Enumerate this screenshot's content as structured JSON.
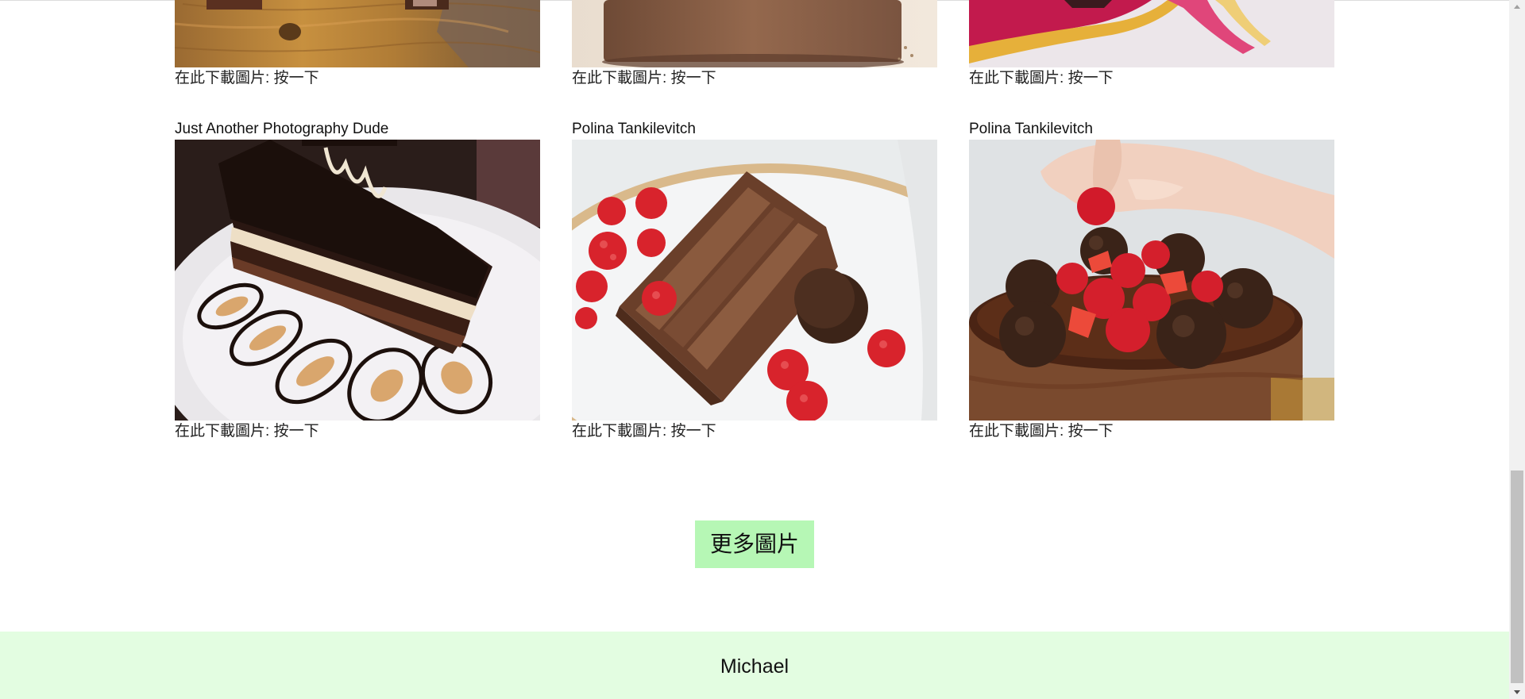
{
  "gallery": {
    "top_row": [
      {
        "download_label": "在此下載圖片: ",
        "download_link": "按一下"
      },
      {
        "download_label": "在此下載圖片: ",
        "download_link": "按一下"
      },
      {
        "download_label": "在此下載圖片: ",
        "download_link": "按一下"
      }
    ],
    "bottom_row": [
      {
        "author": "Just Another Photography Dude",
        "download_label": "在此下載圖片: ",
        "download_link": "按一下",
        "photo": "chocolate-cake-slice-on-plate-photo"
      },
      {
        "author": "Polina Tankilevitch",
        "download_label": "在此下載圖片: ",
        "download_link": "按一下",
        "photo": "chocolate-layer-cake-with-raspberries-photo"
      },
      {
        "author": "Polina Tankilevitch",
        "download_label": "在此下載圖片: ",
        "download_link": "按一下",
        "photo": "chocolate-cake-with-raspberries-and-truffles-photo"
      }
    ]
  },
  "more_button": {
    "label": "更多圖片",
    "color": "#b6f7b5"
  },
  "footer": {
    "name": "Michael",
    "background": "#e3fde1"
  }
}
